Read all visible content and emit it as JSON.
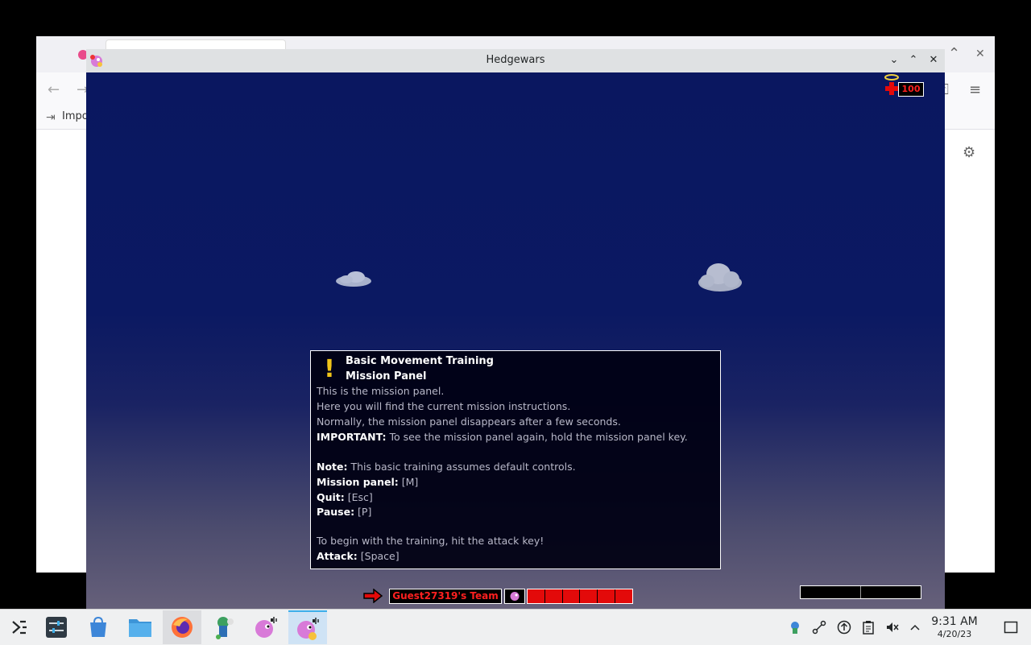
{
  "browser": {
    "bookmark_import_label": "Impo"
  },
  "window": {
    "title": "Hedgewars",
    "minimize_glyph": "⌄",
    "maximize_glyph": "⌃",
    "close_glyph": "✕"
  },
  "hud": {
    "health_value": "100",
    "team_name": "Guest27319's Team",
    "team_health_segments": 6,
    "wind_level": 0
  },
  "mission": {
    "title": "Basic Movement Training",
    "subtitle": "Mission Panel",
    "intro_1": "This is the mission panel.",
    "intro_2": "Here you will find the current mission instructions.",
    "intro_3": "Normally, the mission panel disappears after a few seconds.",
    "important_label": "IMPORTANT:",
    "important_text": " To see the mission panel again, hold the mission panel key.",
    "note_label": "Note:",
    "note_text": " This basic training assumes default controls.",
    "mission_panel_label": "Mission panel:",
    "mission_panel_key": " [M]",
    "quit_label": "Quit:",
    "quit_key": " [Esc]",
    "pause_label": "Pause:",
    "pause_key": " [P]",
    "begin_text": "To begin with the training, hit the attack key!",
    "attack_label": "Attack:",
    "attack_key": " [Space]"
  },
  "taskbar": {
    "time": "9:31 AM",
    "date": "4/20/23"
  },
  "colors": {
    "sky": "#0b1962",
    "panel_border": "#ffffff",
    "team_color": "#ff2020",
    "taskbar": "#eff0f1",
    "active_task": "#3daee9"
  }
}
